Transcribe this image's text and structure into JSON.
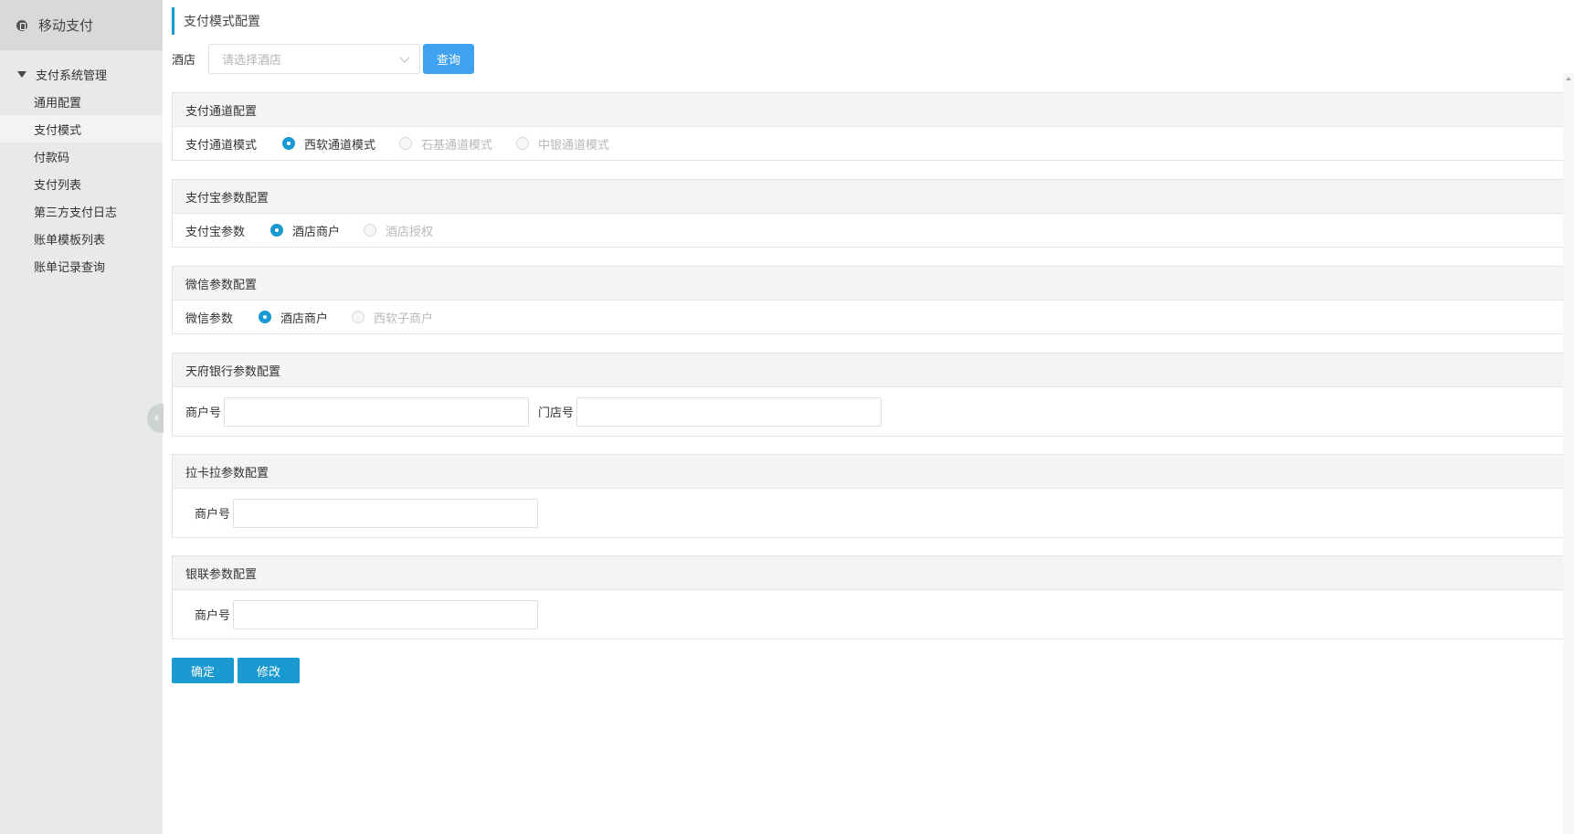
{
  "sidebar": {
    "app_title": "移动支付",
    "group_label": "支付系统管理",
    "items": [
      {
        "label": "通用配置"
      },
      {
        "label": "支付模式"
      },
      {
        "label": "付款码"
      },
      {
        "label": "支付列表"
      },
      {
        "label": "第三方支付日志"
      },
      {
        "label": "账单模板列表"
      },
      {
        "label": "账单记录查询"
      }
    ],
    "active_item": "支付模式"
  },
  "page": {
    "title": "支付模式配置"
  },
  "filter": {
    "hotel_label": "酒店",
    "hotel_placeholder": "请选择酒店",
    "query_button": "查询"
  },
  "panels": {
    "channel": {
      "title": "支付通道配置",
      "label": "支付通道模式",
      "options": [
        "西软通道模式",
        "石基通道模式",
        "中银通道模式"
      ],
      "selected": "西软通道模式"
    },
    "alipay": {
      "title": "支付宝参数配置",
      "label": "支付宝参数",
      "options": [
        "酒店商户",
        "酒店授权"
      ],
      "selected": "酒店商户"
    },
    "wechat": {
      "title": "微信参数配置",
      "label": "微信参数",
      "options": [
        "酒店商户",
        "西软子商户"
      ],
      "selected": "酒店商户"
    },
    "tianfu": {
      "title": "天府银行参数配置",
      "merchant_label": "商户号",
      "merchant_value": "",
      "store_label": "门店号",
      "store_value": ""
    },
    "lakala": {
      "title": "拉卡拉参数配置",
      "merchant_label": "商户号",
      "merchant_value": ""
    },
    "unionpay": {
      "title": "银联参数配置",
      "merchant_label": "商户号",
      "merchant_value": ""
    }
  },
  "actions": {
    "confirm": "确定",
    "modify": "修改"
  },
  "colors": {
    "accent": "#1a9ad0",
    "query_button": "#3fa3f2",
    "sidebar_bg": "#e8e9e9"
  }
}
